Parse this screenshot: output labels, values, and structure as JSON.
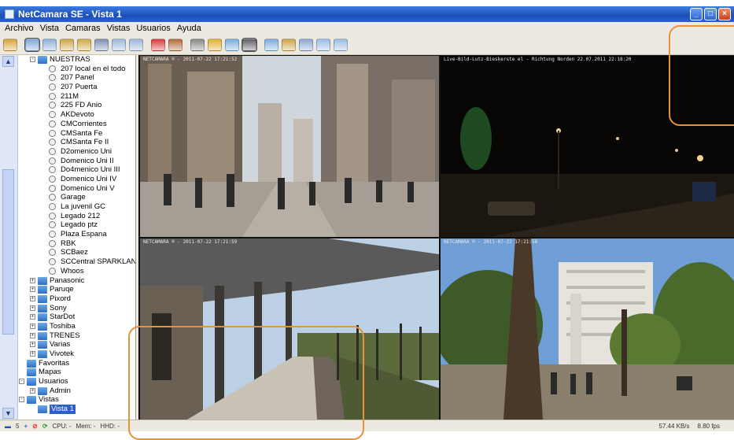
{
  "window": {
    "title": "NetCamara SE - Vista 1",
    "buttons": [
      "minimize",
      "maximize",
      "close"
    ]
  },
  "menu": [
    "Archivo",
    "Vista",
    "Camaras",
    "Vistas",
    "Usuarios",
    "Ayuda"
  ],
  "toolbar": {
    "buttons": [
      {
        "icon": "folder-icon",
        "color": "#d9a43a"
      },
      {
        "icon": "camera-select-icon",
        "color": "#7fa8d8",
        "selected": true
      },
      {
        "icon": "monitor-icon",
        "color": "#8fb0d6"
      },
      {
        "icon": "layout-icon",
        "color": "#cfa54a"
      },
      {
        "icon": "layout-icon",
        "color": "#d1a842"
      },
      {
        "icon": "settings-icon",
        "color": "#7d8fb0"
      },
      {
        "icon": "monitor-icon",
        "color": "#9cb7dc"
      },
      {
        "icon": "monitor-icon",
        "color": "#9cb7dc"
      },
      {
        "icon": "record-icon",
        "color": "#d83a3a"
      },
      {
        "icon": "info-icon",
        "color": "#b06a3a"
      },
      {
        "icon": "printer-icon",
        "color": "#888888"
      },
      {
        "icon": "alarm-icon",
        "color": "#e0b030"
      },
      {
        "icon": "monitor-icon",
        "color": "#7aaedf"
      },
      {
        "icon": "ptz-icon",
        "color": "#606060",
        "selected": true
      },
      {
        "icon": "monitor-icon",
        "color": "#7aaedf"
      },
      {
        "icon": "layout-icon",
        "color": "#d0a44a"
      },
      {
        "icon": "monitor-icon",
        "color": "#8aa7d3"
      },
      {
        "icon": "monitor-icon",
        "color": "#9bbbe3"
      },
      {
        "icon": "monitor-icon",
        "color": "#9bbbe3"
      }
    ]
  },
  "tree": [
    {
      "label": "NUESTRAS",
      "type": "folder",
      "indent": 1,
      "expander": "-"
    },
    {
      "label": "207 local en el todo",
      "type": "camera",
      "indent": 2
    },
    {
      "label": "207 Panel",
      "type": "camera",
      "indent": 2
    },
    {
      "label": "207 Puerta",
      "type": "camera",
      "indent": 2
    },
    {
      "label": "211M",
      "type": "camera",
      "indent": 2
    },
    {
      "label": "225 FD Anio",
      "type": "camera",
      "indent": 2
    },
    {
      "label": "AKDevoto",
      "type": "camera",
      "indent": 2
    },
    {
      "label": "CMCorrientes",
      "type": "camera",
      "indent": 2
    },
    {
      "label": "CMSanta Fe",
      "type": "camera",
      "indent": 2
    },
    {
      "label": "CMSanta Fe II",
      "type": "camera",
      "indent": 2
    },
    {
      "label": "D2omenico Uni",
      "type": "camera",
      "indent": 2
    },
    {
      "label": "Domenico Uni II",
      "type": "camera",
      "indent": 2
    },
    {
      "label": "Do4menico Uni III",
      "type": "camera",
      "indent": 2
    },
    {
      "label": "Domenico Uni IV",
      "type": "camera",
      "indent": 2
    },
    {
      "label": "Domenico Uni V",
      "type": "camera",
      "indent": 2
    },
    {
      "label": "Garage",
      "type": "camera",
      "indent": 2
    },
    {
      "label": "La juvenil GC",
      "type": "camera",
      "indent": 2
    },
    {
      "label": "Legado 212",
      "type": "camera",
      "indent": 2
    },
    {
      "label": "Legado ptz",
      "type": "camera",
      "indent": 2
    },
    {
      "label": "Plaza Espana",
      "type": "camera",
      "indent": 2
    },
    {
      "label": "RBK",
      "type": "camera",
      "indent": 2
    },
    {
      "label": "SCBaez",
      "type": "camera",
      "indent": 2
    },
    {
      "label": "SCCentral SPARKLAN",
      "type": "camera",
      "indent": 2
    },
    {
      "label": "Whoos",
      "type": "camera",
      "indent": 2
    },
    {
      "label": "Panasonic",
      "type": "folder",
      "indent": 1,
      "expander": "+"
    },
    {
      "label": "Paruqe",
      "type": "folder",
      "indent": 1,
      "expander": "+"
    },
    {
      "label": "Pixord",
      "type": "folder",
      "indent": 1,
      "expander": "+"
    },
    {
      "label": "Sony",
      "type": "folder",
      "indent": 1,
      "expander": "+"
    },
    {
      "label": "StarDot",
      "type": "folder",
      "indent": 1,
      "expander": "+"
    },
    {
      "label": "Toshiba",
      "type": "folder",
      "indent": 1,
      "expander": "+"
    },
    {
      "label": "TRENES",
      "type": "folder",
      "indent": 1,
      "expander": "+"
    },
    {
      "label": "Varias",
      "type": "folder",
      "indent": 1,
      "expander": "+"
    },
    {
      "label": "Vivotek",
      "type": "folder",
      "indent": 1,
      "expander": "+"
    },
    {
      "label": "Favoritas",
      "type": "folder",
      "indent": 0
    },
    {
      "label": "Mapas",
      "type": "folder",
      "indent": 0
    },
    {
      "label": "Usuarios",
      "type": "folder",
      "indent": 0,
      "expander": "-"
    },
    {
      "label": "Admin",
      "type": "folder",
      "indent": 1,
      "expander": "+"
    },
    {
      "label": "Vistas",
      "type": "folder",
      "indent": 0,
      "expander": "-"
    },
    {
      "label": "Vista 1",
      "type": "folder",
      "indent": 1,
      "selected": true
    }
  ],
  "cameras": [
    {
      "osd": "NETCAMARA ® - 2011-07-22 17:21:52",
      "scene": "city-street-day"
    },
    {
      "osd": "Live-Bild-Lutz-Bieskerste el - Richtung Norden 22.07.2011 22:18:20",
      "scene": "street-night"
    },
    {
      "osd": "NETCAMARA ® - 2011-07-22 17:21:59",
      "scene": "train-station"
    },
    {
      "osd": "NETCAMARA ® - 2011-07-22 17:21:58",
      "scene": "plaza-palms"
    }
  ],
  "status": {
    "count": "5",
    "cpu": "CPU: -",
    "mem": "Mem: -",
    "hdd": "HHD: -",
    "rate": "57.44 KB/s",
    "fps": "8.80 fps"
  },
  "colors": {
    "titlebar": "#1a4fb8",
    "selection": "#2d5fc4",
    "highlight": "#e8913b"
  }
}
